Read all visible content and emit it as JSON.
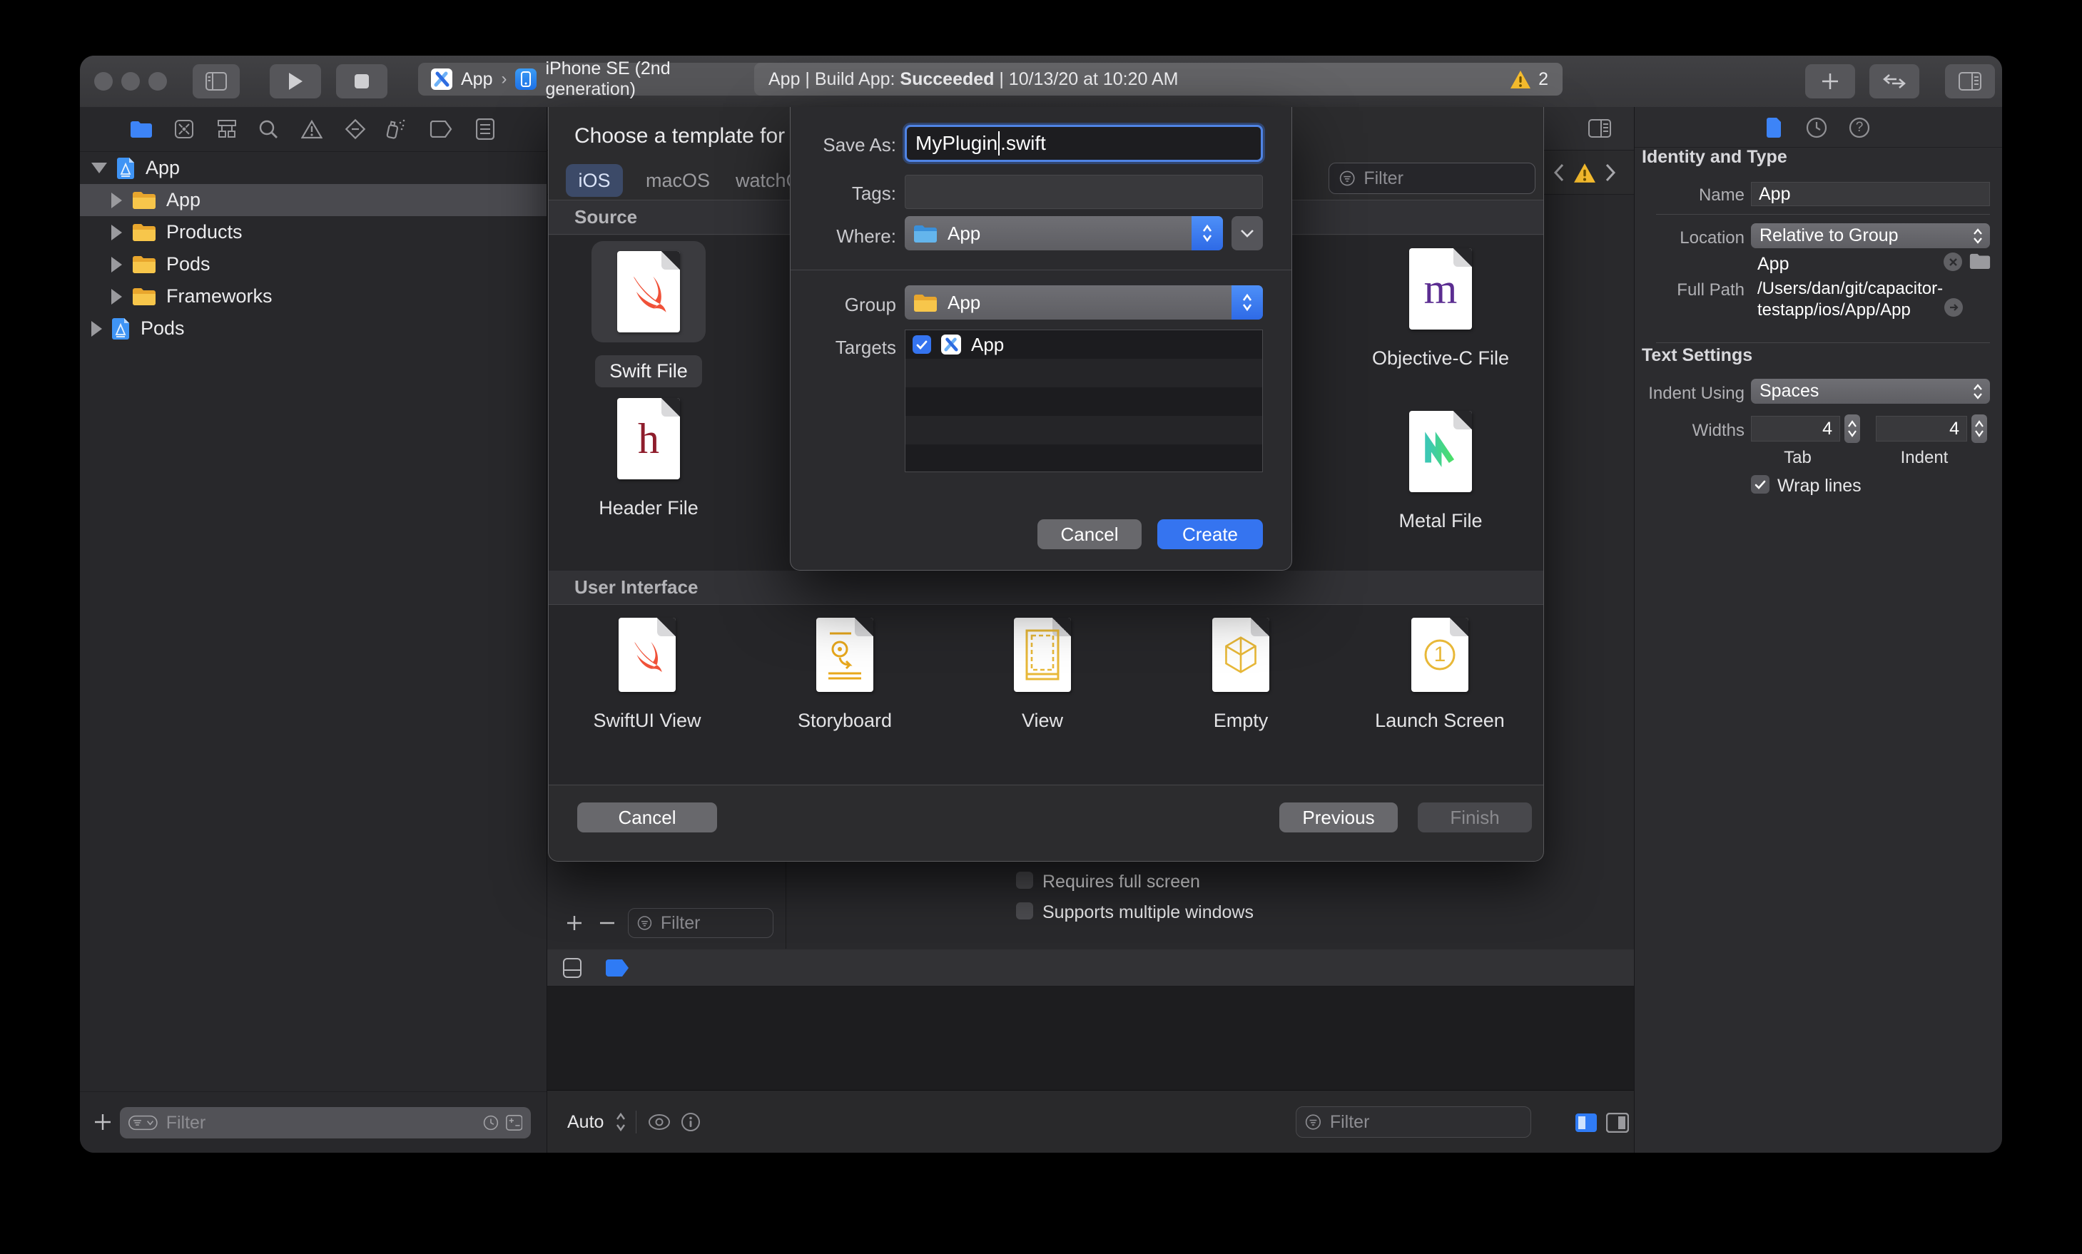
{
  "titlebar": {
    "scheme_project": "App",
    "scheme_separator": "›",
    "scheme_device": "iPhone SE (2nd generation)",
    "status_prefix": "App | Build App: ",
    "status_bold": "Succeeded",
    "status_suffix": " | 10/13/20 at 10:20 AM",
    "warning_count": "2"
  },
  "navigator": {
    "items": [
      {
        "label": "App"
      },
      {
        "label": "App"
      },
      {
        "label": "Products"
      },
      {
        "label": "Pods"
      },
      {
        "label": "Frameworks"
      },
      {
        "label": "Pods"
      }
    ],
    "filter_placeholder": "Filter"
  },
  "sheet": {
    "title": "Choose a template for your",
    "tab_ios": "iOS",
    "tab_macos": "macOS",
    "tab_watchos": "watchOS",
    "filter_placeholder": "Filter",
    "section_source": "Source",
    "section_ui": "User Interface",
    "items": {
      "swift": "Swift File",
      "header": "Header File",
      "objc": "Objective-C File",
      "metal": "Metal File",
      "swiftui": "SwiftUI View",
      "storyboard": "Storyboard",
      "view": "View",
      "empty": "Empty",
      "launch": "Launch Screen"
    },
    "cancel": "Cancel",
    "previous": "Previous",
    "finish": "Finish"
  },
  "dialog": {
    "save_as_label": "Save As:",
    "filename": "MyPlugin",
    "extension": ".swift",
    "tags_label": "Tags:",
    "where_label": "Where:",
    "where_value": "App",
    "group_label": "Group",
    "group_value": "App",
    "targets_label": "Targets",
    "target_name": "App",
    "cancel": "Cancel",
    "create": "Create"
  },
  "editor": {
    "checkbox1": "Requires full screen",
    "checkbox2": "Supports multiple windows",
    "filter_placeholder": "Filter",
    "auto_label": "Auto",
    "debug_filter_placeholder": "Filter"
  },
  "inspector": {
    "identity_header": "Identity and Type",
    "name_label": "Name",
    "name_value": "App",
    "location_label": "Location",
    "location_value": "Relative to Group",
    "location_folder": "App",
    "fullpath_label": "Full Path",
    "fullpath_line1": "/Users/dan/git/capacitor-",
    "fullpath_line2": "testapp/ios/App/App",
    "textsettings_header": "Text Settings",
    "indent_label": "Indent Using",
    "indent_value": "Spaces",
    "widths_label": "Widths",
    "tab_value": "4",
    "tab_caption": "Tab",
    "indent_num_value": "4",
    "indent_caption": "Indent",
    "wrap_label": "Wrap lines"
  },
  "icons": {
    "help_glyph": "?",
    "launch_glyph": "1",
    "header_glyph": "h",
    "objc_glyph": "m"
  },
  "colors": {
    "accent": "#3574f0",
    "warning": "#f7bd2e",
    "swift_orange": "#f05138",
    "metal_teal": "#3cc8a4",
    "folder_yellow": "#f0b42e"
  }
}
